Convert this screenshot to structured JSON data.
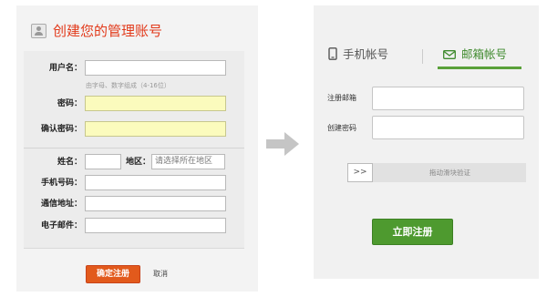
{
  "left": {
    "title": "创建您的管理账号",
    "username_label": "用户名：",
    "username_hint": "由字母、数字组成（4-16位）",
    "password_label": "密码：",
    "confirm_password_label": "确认密码：",
    "name_label": "姓名：",
    "region_label": "地区：",
    "region_placeholder": "请选择所在地区",
    "phone_label": "手机号码：",
    "address_label": "通信地址：",
    "email_label": "电子邮件：",
    "confirm_button": "确定注册",
    "cancel_link": "取消"
  },
  "right": {
    "tab_phone": "手机帐号",
    "tab_email": "邮箱帐号",
    "email_label": "注册邮箱",
    "password_label": "创建密码",
    "slider_handle": ">>",
    "slider_text": "拖动滑块验证",
    "register_button": "立即注册"
  },
  "colors": {
    "title_red": "#e23a1b",
    "accent_green": "#4e9a2f",
    "highlight_yellow": "#fbfbbd",
    "confirm_orange": "#e25a1c"
  }
}
